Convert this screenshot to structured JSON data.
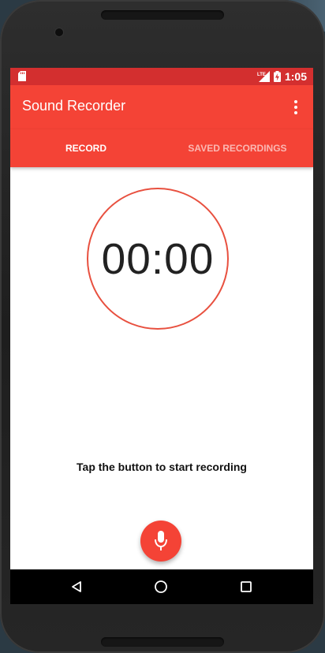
{
  "status_bar": {
    "network": "LTE",
    "time": "1:05"
  },
  "toolbar": {
    "title": "Sound Recorder",
    "menu_icon": "more-vert-icon"
  },
  "tabs": [
    {
      "label": "RECORD",
      "selected": true
    },
    {
      "label": "SAVED RECORDINGS",
      "selected": false
    }
  ],
  "recorder": {
    "timer": "00:00",
    "hint": "Tap the button to start recording",
    "record_icon": "microphone-icon"
  },
  "nav": {
    "back_icon": "back-triangle-icon",
    "home_icon": "home-circle-icon",
    "recents_icon": "recents-square-icon"
  },
  "colors": {
    "primary": "#f44336",
    "primary_dark": "#d32f2f",
    "ring": "#e8503f"
  }
}
